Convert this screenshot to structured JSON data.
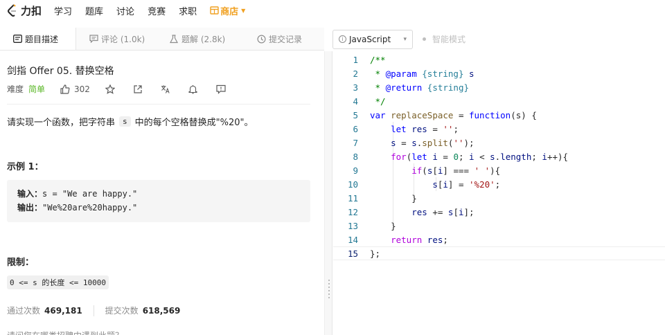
{
  "nav": {
    "logo_text": "力扣",
    "items": [
      "学习",
      "题库",
      "讨论",
      "竞赛",
      "求职"
    ],
    "store_label": "商店"
  },
  "tabs": [
    {
      "label": "题目描述",
      "icon": "description-icon"
    },
    {
      "label": "评论 (1.0k)",
      "icon": "comment-icon"
    },
    {
      "label": "题解 (2.8k)",
      "icon": "flask-icon"
    },
    {
      "label": "提交记录",
      "icon": "clock-icon"
    }
  ],
  "editor_bar": {
    "language": "JavaScript",
    "smart_mode": "智能模式"
  },
  "problem": {
    "title": "剑指 Offer 05. 替换空格",
    "difficulty_label": "难度",
    "difficulty": "简单",
    "likes": "302",
    "description_before": "请实现一个函数，把字符串",
    "description_code": "s",
    "description_after": "中的每个空格替换成\"%20\"。",
    "example_title": "示例 1：",
    "example_input_label": "输入：",
    "example_input": "s = \"We are happy.\"",
    "example_output_label": "输出：",
    "example_output": "\"We%20are%20happy.\"",
    "limit_title": "限制：",
    "limit": "0 <= s 的长度 <= 10000",
    "accepted_label": "通过次数",
    "accepted": "469,181",
    "submitted_label": "提交次数",
    "submitted": "618,569",
    "more": "请问您在哪类招聘中遇到此题？"
  },
  "code_lines": [
    "1",
    "2",
    "3",
    "4",
    "5",
    "6",
    "7",
    "8",
    "9",
    "10",
    "11",
    "12",
    "13",
    "14",
    "15"
  ]
}
